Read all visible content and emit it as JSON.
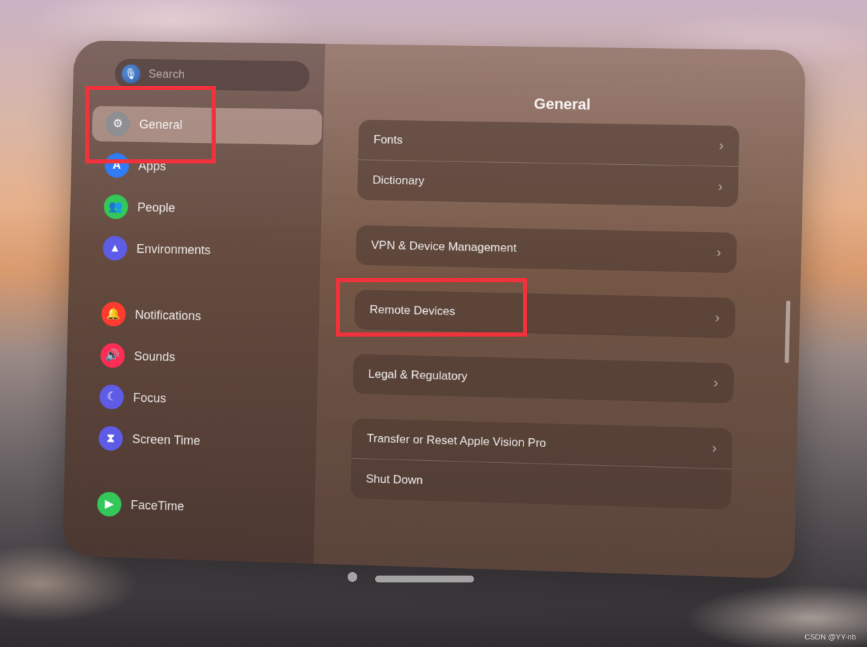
{
  "sidebar": {
    "search_placeholder": "Search",
    "items": [
      {
        "label": "General",
        "icon": "gear-icon",
        "color": "#8e8e93"
      },
      {
        "label": "Apps",
        "icon": "app-store-icon",
        "color": "#2f7cf6"
      },
      {
        "label": "People",
        "icon": "people-icon",
        "color": "#34c759"
      },
      {
        "label": "Environments",
        "icon": "mountains-icon",
        "color": "#5e5ce6"
      },
      {
        "label": "Notifications",
        "icon": "bell-icon",
        "color": "#ff3b30"
      },
      {
        "label": "Sounds",
        "icon": "speaker-icon",
        "color": "#ff2d55"
      },
      {
        "label": "Focus",
        "icon": "moon-icon",
        "color": "#5e5ce6"
      },
      {
        "label": "Screen Time",
        "icon": "hourglass-icon",
        "color": "#5e5ce6"
      },
      {
        "label": "FaceTime",
        "icon": "video-camera-icon",
        "color": "#34c759"
      }
    ]
  },
  "main": {
    "title": "General",
    "groups": [
      {
        "rows": [
          {
            "label": "Fonts",
            "chevron": "›"
          },
          {
            "label": "Dictionary",
            "chevron": "›"
          }
        ]
      },
      {
        "rows": [
          {
            "label": "VPN & Device Management",
            "chevron": "›"
          }
        ]
      },
      {
        "rows": [
          {
            "label": "Remote Devices",
            "chevron": "›"
          }
        ]
      },
      {
        "rows": [
          {
            "label": "Legal & Regulatory",
            "chevron": "›"
          }
        ]
      },
      {
        "rows": [
          {
            "label": "Transfer or Reset Apple Vision Pro",
            "chevron": "›"
          },
          {
            "label": "Shut Down",
            "chevron": ""
          }
        ]
      }
    ]
  },
  "annotation_color": "#f0323c",
  "watermark": "CSDN @YY-nb"
}
